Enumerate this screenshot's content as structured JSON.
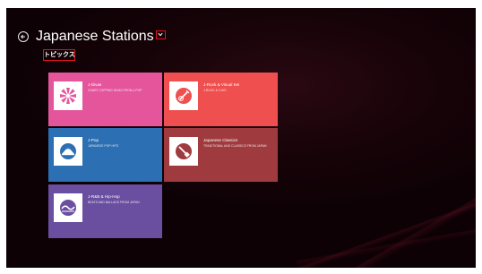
{
  "header": {
    "title": "Japanese Stations",
    "section_label": "トピックス"
  },
  "tiles": [
    {
      "name": "J-Divas",
      "description": "Chart-topping divas from J-Pop",
      "color": "#e5559b",
      "icon": "pinwheel-icon"
    },
    {
      "name": "J-Rock & Visual Kei",
      "description": "J-Rock & V-Kei",
      "color": "#ef4f4f",
      "icon": "guitar-icon"
    },
    {
      "name": "J-Pop",
      "description": "Japanese pop hits",
      "color": "#2c6fb2",
      "icon": "mountain-icon"
    },
    {
      "name": "Japanese Classics",
      "description": "Traditional and classics from Japan",
      "color": "#9f3a3e",
      "icon": "shamisen-icon"
    },
    {
      "name": "J-R&B & Hip-Hop",
      "description": "Beats and ballads from Japan",
      "color": "#6a4ea0",
      "icon": "wave-icon"
    }
  ],
  "colors": {
    "background": "#160308",
    "highlight": "#e0141e"
  }
}
